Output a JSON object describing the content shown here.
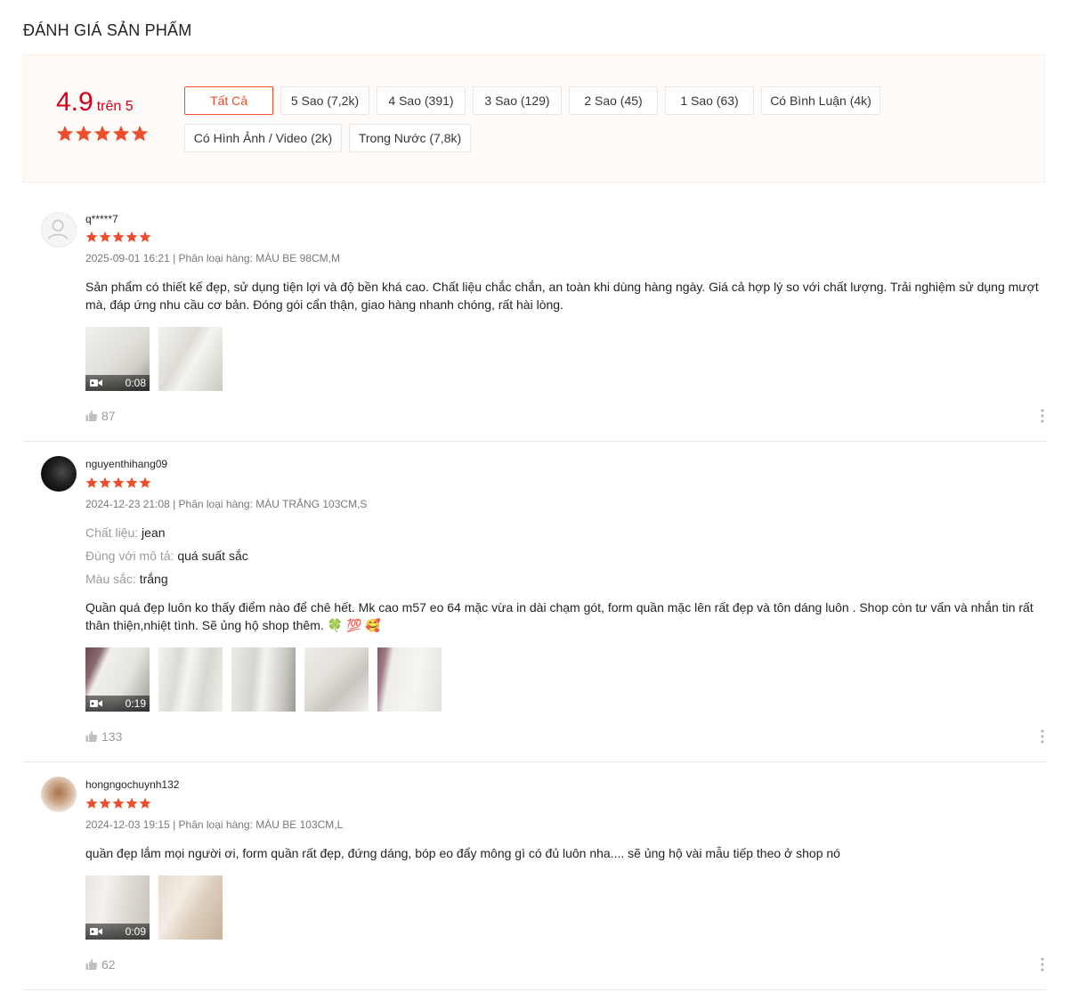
{
  "section_title": "ĐÁNH GIÁ SẢN PHẨM",
  "overview": {
    "score": "4.9",
    "score_suffix": "trên 5",
    "rating_stars": 5,
    "filters": [
      {
        "label": "Tất Cả",
        "active": true
      },
      {
        "label": "5 Sao (7,2k)"
      },
      {
        "label": "4 Sao (391)"
      },
      {
        "label": "3 Sao (129)"
      },
      {
        "label": "2 Sao (45)"
      },
      {
        "label": "1 Sao (63)"
      },
      {
        "label": "Có Bình Luận (4k)"
      },
      {
        "label": "Có Hình Ảnh / Video (2k)"
      },
      {
        "label": "Trong Nước (7,8k)"
      }
    ]
  },
  "colors": {
    "accent": "#ee4d2d",
    "score": "#d0011b",
    "star": "#ee4d2d"
  },
  "reviews": [
    {
      "username": "q*****7",
      "stars": 5,
      "meta": "2025-09-01 16:21 | Phân loại hàng: MÀU BE 98CM,M",
      "attributes": [],
      "content": "Sản phẩm có thiết kế đẹp, sử dụng tiện lợi và độ bền khá cao. Chất liệu chắc chắn, an toàn khi dùng hàng ngày. Giá cả hợp lý so với chất lượng. Trải nghiệm sử dụng mượt mà, đáp ứng nhu cầu cơ bản. Đóng gói cẩn thận, giao hàng nhanh chóng, rất hài lòng.",
      "video_duration": "0:08",
      "likes": "87"
    },
    {
      "username": "nguyenthihang09",
      "stars": 5,
      "meta": "2024-12-23 21:08 | Phân loại hàng: MÀU TRẮNG 103CM,S",
      "attributes": [
        {
          "key": "Chất liệu:",
          "value": "jean"
        },
        {
          "key": "Đúng với mô tả:",
          "value": "quá suất sắc"
        },
        {
          "key": "Màu sắc:",
          "value": "trắng"
        }
      ],
      "content": "Quần quá đẹp luôn ko thấy điểm nào để chê hết.  Mk cao m57 eo 64 mặc vừa in dài chạm gót, form quần mặc lên rất đẹp và tôn dáng luôn . Shop còn tư vấn và nhắn tin rất thân thiện,nhiệt tình. Sẽ ủng hộ shop thêm. 🍀 💯 🥰",
      "video_duration": "0:19",
      "likes": "133"
    },
    {
      "username": "hongngochuynh132",
      "stars": 5,
      "meta": "2024-12-03 19:15 | Phân loại hàng: MÀU BE 103CM,L",
      "attributes": [],
      "content": "quần đẹp lắm mọi người ơi, form quần rất đẹp, đứng dáng, bóp eo đẩy mông gì có đủ luôn nha.... sẽ ủng hộ vài mẫu tiếp theo ở shop nó",
      "video_duration": "0:09",
      "likes": "62"
    }
  ]
}
